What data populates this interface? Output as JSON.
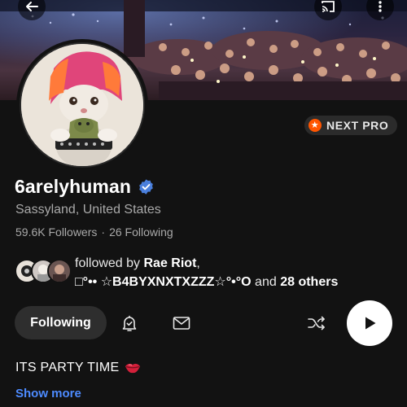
{
  "header": {
    "back_icon": "arrow-left-icon",
    "cast_icon": "cast-icon",
    "more_icon": "more-vertical-icon"
  },
  "badge": {
    "label": "NEXT PRO",
    "color": "#ff5500"
  },
  "profile": {
    "username": "6arelyhuman",
    "verified": true,
    "location": "Sassyland, United States",
    "followers": "59.6K Followers",
    "separator": "·",
    "following": "26 Following"
  },
  "followed_by": {
    "prefix": "followed by",
    "first": "Rae Riot",
    "comma": ",",
    "second": "□°•• ☆B4BYXNXTXZZZ☆°•°O",
    "and": "and",
    "others": "28 others"
  },
  "actions": {
    "following_label": "Following",
    "notify_icon": "bell-check-icon",
    "message_icon": "mail-icon",
    "shuffle_icon": "shuffle-icon",
    "play_icon": "play-icon"
  },
  "bio": {
    "text": "ITS PARTY TIME",
    "emoji": "lips-icon",
    "show_more": "Show more"
  },
  "colors": {
    "background": "#121212",
    "link": "#4d8bff",
    "verified": "#4a7fdc"
  }
}
